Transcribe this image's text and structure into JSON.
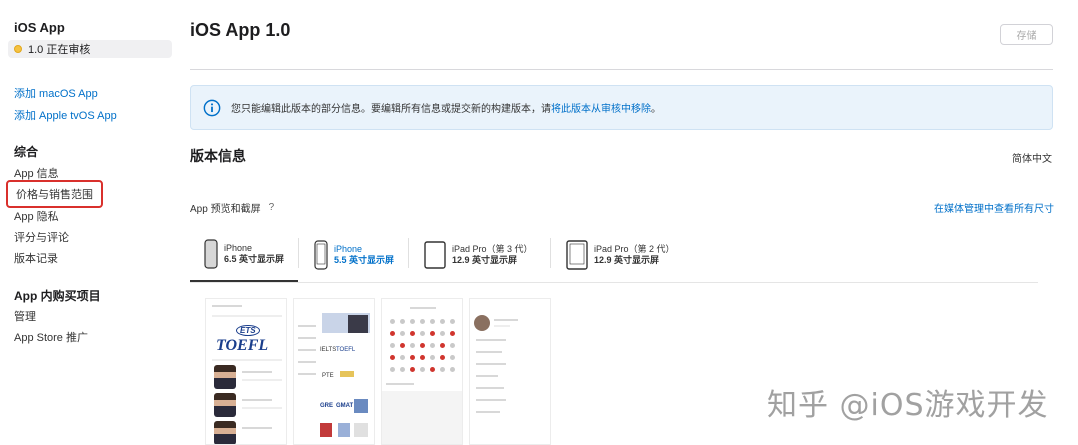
{
  "sidebar": {
    "app_title": "iOS App",
    "version_status": "1.0 正在审核",
    "add_macos": "添加 macOS App",
    "add_tvos": "添加 Apple tvOS App",
    "general_heading": "综合",
    "general_items": [
      "App 信息",
      "价格与销售范围",
      "App 隐私",
      "评分与评论",
      "版本记录"
    ],
    "iap_heading": "App 内购买项目",
    "iap_items": [
      "管理",
      "App Store 推广"
    ]
  },
  "header": {
    "title": "iOS App 1.0",
    "save_label": "存储"
  },
  "notice": {
    "text": "您只能编辑此版本的部分信息。要编辑所有信息或提交新的构建版本，请",
    "link": "将此版本从审核中移除",
    "suffix": "。"
  },
  "version_info": {
    "title": "版本信息",
    "language": "简体中文"
  },
  "preview": {
    "label": "App 预览和截屏",
    "help": "?",
    "media_link": "在媒体管理中查看所有尺寸"
  },
  "device_tabs": [
    {
      "name": "iPhone",
      "size": "6.5 英寸显示屏"
    },
    {
      "name": "iPhone",
      "size": "5.5 英寸显示屏"
    },
    {
      "name": "iPad Pro（第 3 代）",
      "size": "12.9 英寸显示屏"
    },
    {
      "name": "iPad Pro（第 2 代）",
      "size": "12.9 英寸显示屏"
    }
  ],
  "screenshots": {
    "toefl_text": "TOEFL",
    "ets_text": "ETS",
    "exam_labels": [
      "IELTS",
      "TOEFL",
      "PTE",
      "GRE",
      "GMAT"
    ]
  },
  "watermark": "知乎 @iOS游戏开发",
  "colors": {
    "accent": "#0070c9",
    "highlight_border": "#d9302c",
    "status_dot": "#f5c242",
    "notice_bg": "#eaf3fb"
  }
}
